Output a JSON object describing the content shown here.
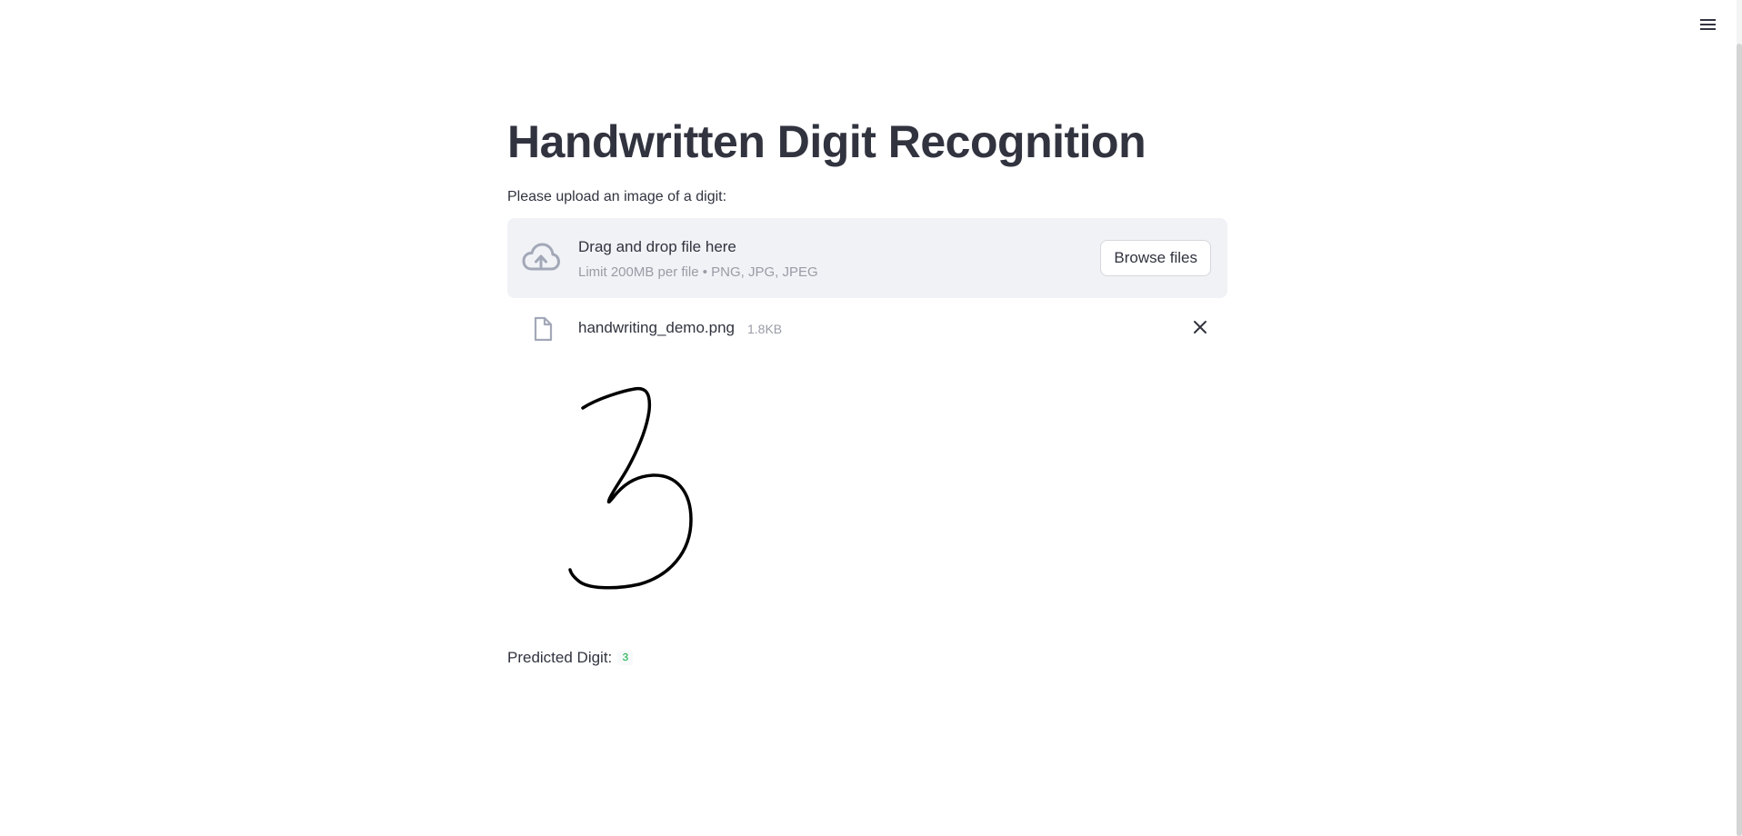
{
  "header": {
    "menu_icon": "hamburger-menu-icon"
  },
  "page": {
    "title": "Handwritten Digit Recognition"
  },
  "uploader": {
    "label": "Please upload an image of a digit:",
    "icon": "cloud-upload-icon",
    "drop_title": "Drag and drop file here",
    "drop_limit": "Limit 200MB per file • PNG, JPG, JPEG",
    "browse_label": "Browse files",
    "uploaded_file": {
      "icon": "file-icon",
      "name": "handwriting_demo.png",
      "size": "1.8KB",
      "remove_icon": "close-icon"
    }
  },
  "preview": {
    "image": "handwritten-digit-3-image"
  },
  "result": {
    "label": "Predicted Digit:",
    "value": "3"
  },
  "colors": {
    "text": "#31333f",
    "muted": "#9a9ca6",
    "dropzone_bg": "#f0f2f6",
    "icon": "#a3a8b8",
    "prediction": "#09ab3b"
  }
}
